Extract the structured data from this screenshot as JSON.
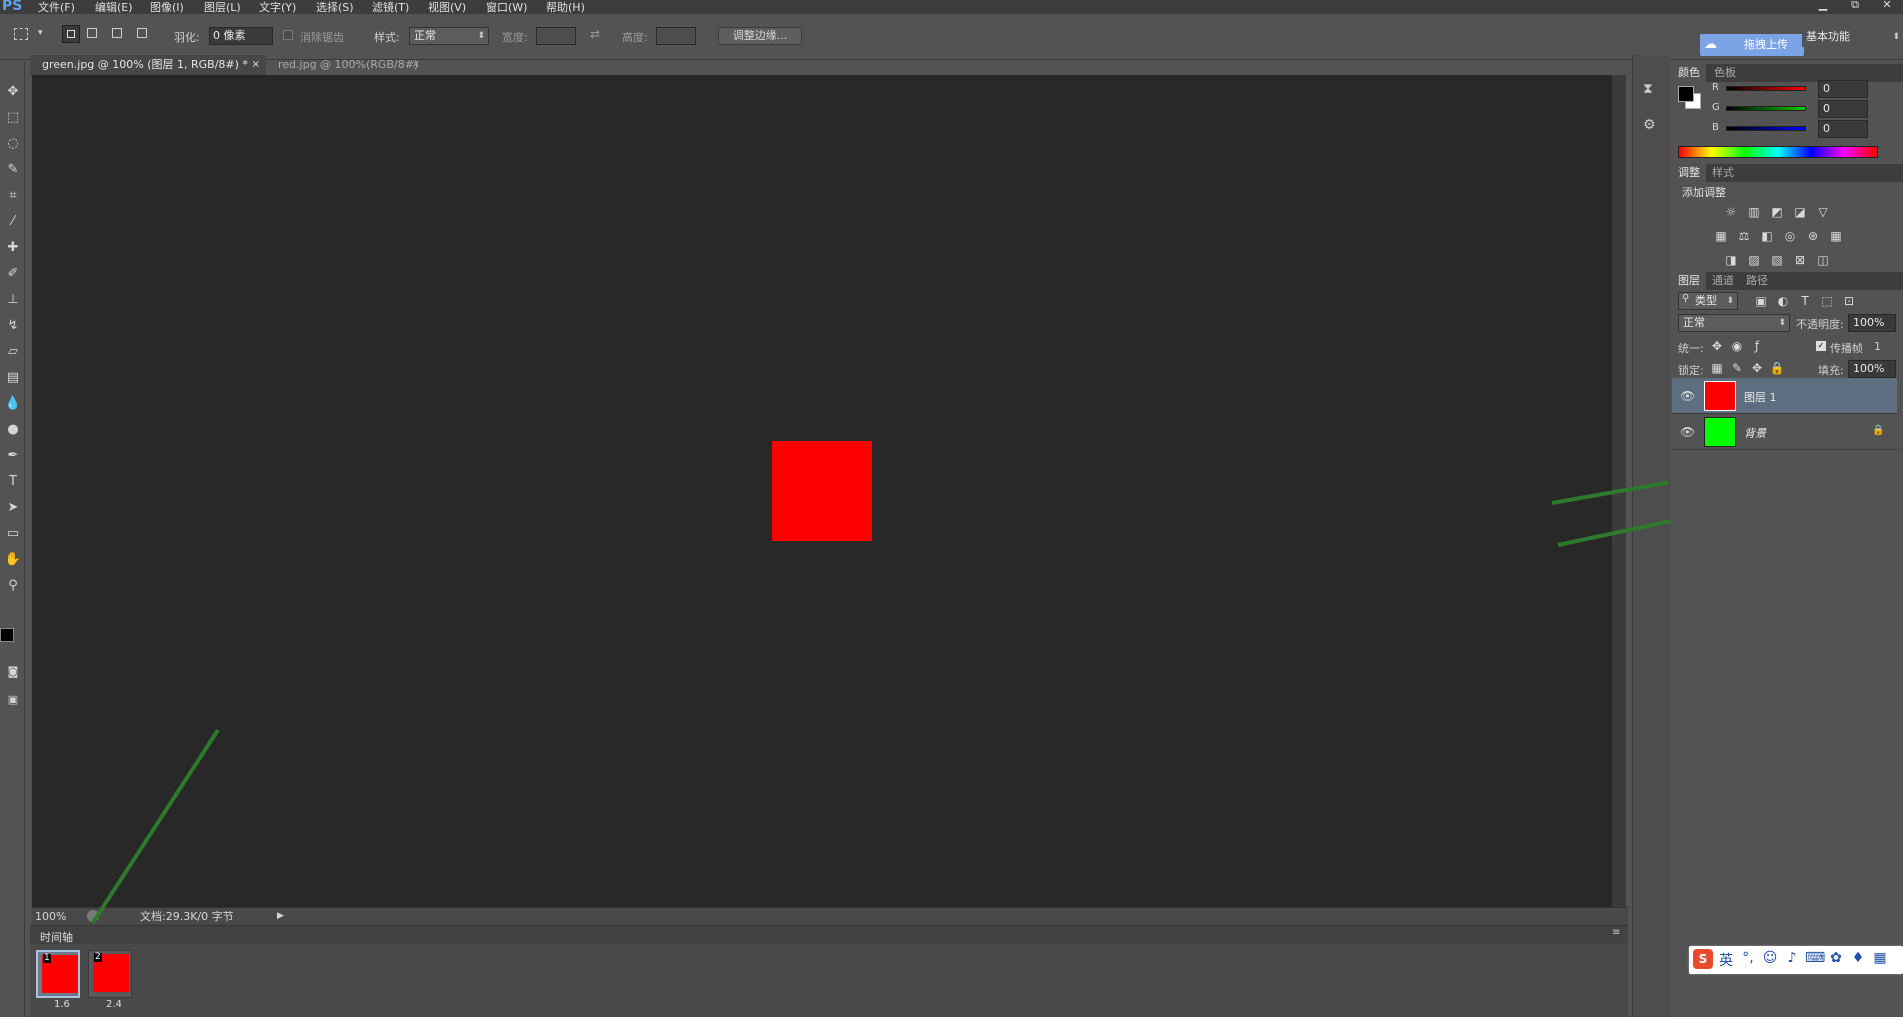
{
  "app": {
    "logo": "PS"
  },
  "menu": [
    "文件(F)",
    "编辑(E)",
    "图像(I)",
    "图层(L)",
    "文字(Y)",
    "选择(S)",
    "滤镜(T)",
    "视图(V)",
    "窗口(W)",
    "帮助(H)"
  ],
  "window_controls": [
    "▁",
    "⧉",
    "✕"
  ],
  "options": {
    "feather_label": "羽化:",
    "feather_value": "0 像素",
    "antialias_label": "消除锯齿",
    "style_label": "样式:",
    "style_value": "正常",
    "width_label": "宽度:",
    "height_label": "高度:",
    "refine_edge": "调整边缘...",
    "workspace": "基本功能",
    "baidu_upload": "拖拽上传"
  },
  "tabs": [
    {
      "label": "green.jpg @ 100% (图层 1, RGB/8#) *",
      "close": "×"
    },
    {
      "label": "red.jpg @ 100%(RGB/8#)",
      "close": "×"
    }
  ],
  "status": {
    "zoom": "100%",
    "doc": "文档:29.3K/0 字节",
    "arrow": "▶"
  },
  "timeline": {
    "title": "时间轴",
    "frames": [
      {
        "num": "1",
        "time": "1.6",
        "color": "#ff0000"
      },
      {
        "num": "2",
        "time": "2.4",
        "color": "#ff0000"
      }
    ]
  },
  "color_panel": {
    "tabs": [
      "颜色",
      "色板"
    ],
    "channels": [
      {
        "label": "R",
        "value": "0",
        "color": "#e01010"
      },
      {
        "label": "G",
        "value": "0",
        "color": "#10b010"
      },
      {
        "label": "B",
        "value": "0",
        "color": "#1010e0"
      }
    ]
  },
  "adjust_panel": {
    "tabs": [
      "调整",
      "样式"
    ],
    "title": "添加调整"
  },
  "layers_panel": {
    "tabs": [
      "图层",
      "通道",
      "路径"
    ],
    "filter_value": "类型",
    "blend_mode": "正常",
    "opacity_label": "不透明度:",
    "opacity_value": "100%",
    "unify_label": "统一:",
    "propagate_label": "传播帧",
    "propagate_value": "1",
    "lock_label": "锁定:",
    "fill_label": "填充:",
    "fill_value": "100%",
    "layers": [
      {
        "name": "图层 1",
        "color": "#ff0000"
      },
      {
        "name": "背景",
        "color": "#00ff00"
      }
    ]
  },
  "ime": {
    "lang": "英",
    "punct": "°,",
    "logo": "S"
  }
}
